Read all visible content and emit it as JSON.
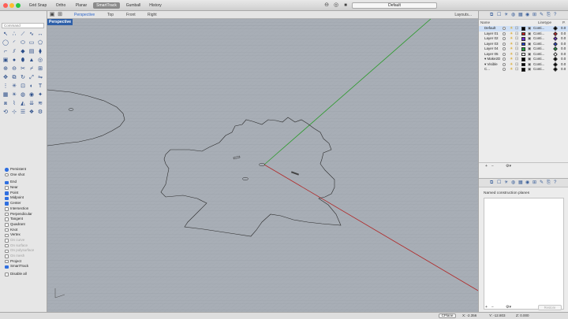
{
  "toolbar": {
    "toggles": [
      {
        "label": "Grid Snap",
        "active": false
      },
      {
        "label": "Ortho",
        "active": false
      },
      {
        "label": "Planar",
        "active": false
      },
      {
        "label": "SmartTrack",
        "active": true
      },
      {
        "label": "Gumball",
        "active": false
      },
      {
        "label": "History",
        "active": false
      }
    ],
    "layer_selector": "Default"
  },
  "viewport_tabs": [
    "Perspective",
    "Top",
    "Front",
    "Right"
  ],
  "active_tab": "Perspective",
  "layouts_label": "Layouts...",
  "command_placeholder": "Command",
  "viewport_label": "Perspective",
  "tools": [
    {
      "icon": "select-arrow-icon",
      "glyph": "↖"
    },
    {
      "icon": "points-icon",
      "glyph": "∴"
    },
    {
      "icon": "polyline-icon",
      "glyph": "⟋"
    },
    {
      "icon": "curve-icon",
      "glyph": "∿"
    },
    {
      "icon": "dimension-icon",
      "glyph": "↔"
    },
    {
      "icon": "circle-icon",
      "glyph": "◯"
    },
    {
      "icon": "arc-icon",
      "glyph": "◜"
    },
    {
      "icon": "ellipse-icon",
      "glyph": "⬭"
    },
    {
      "icon": "rectangle-icon",
      "glyph": "▭"
    },
    {
      "icon": "polygon-icon",
      "glyph": "⬠"
    },
    {
      "icon": "fillet-icon",
      "glyph": "⌐"
    },
    {
      "icon": "offset-icon",
      "glyph": "⫽"
    },
    {
      "icon": "surface-icon",
      "glyph": "◆"
    },
    {
      "icon": "extrude-icon",
      "glyph": "▤"
    },
    {
      "icon": "loft-icon",
      "glyph": "⧫"
    },
    {
      "icon": "box-icon",
      "glyph": "▣"
    },
    {
      "icon": "sphere-icon",
      "glyph": "●"
    },
    {
      "icon": "cylinder-icon",
      "glyph": "⬮"
    },
    {
      "icon": "cone-icon",
      "glyph": "▲"
    },
    {
      "icon": "torus-icon",
      "glyph": "◎"
    },
    {
      "icon": "boolean-union-icon",
      "glyph": "⊕"
    },
    {
      "icon": "boolean-diff-icon",
      "glyph": "⊖"
    },
    {
      "icon": "split-icon",
      "glyph": "✂"
    },
    {
      "icon": "trim-icon",
      "glyph": "⌿"
    },
    {
      "icon": "join-icon",
      "glyph": "⊞"
    },
    {
      "icon": "move-icon",
      "glyph": "✥"
    },
    {
      "icon": "copy-icon",
      "glyph": "⧉"
    },
    {
      "icon": "rotate-icon",
      "glyph": "↻"
    },
    {
      "icon": "scale-icon",
      "glyph": "⤢"
    },
    {
      "icon": "mirror-icon",
      "glyph": "⇋"
    },
    {
      "icon": "array-icon",
      "glyph": "⋮"
    },
    {
      "icon": "explode-icon",
      "glyph": "✳"
    },
    {
      "icon": "group-icon",
      "glyph": "⊡"
    },
    {
      "icon": "analyze-icon",
      "glyph": "◐"
    },
    {
      "icon": "text-icon",
      "glyph": "T"
    },
    {
      "icon": "grid-icon",
      "glyph": "▦"
    },
    {
      "icon": "render-icon",
      "glyph": "☀"
    },
    {
      "icon": "material-icon",
      "glyph": "◍"
    },
    {
      "icon": "camera-icon",
      "glyph": "◉"
    },
    {
      "icon": "light-icon",
      "glyph": "✦"
    },
    {
      "icon": "mesh-icon",
      "glyph": "⧈"
    },
    {
      "icon": "curve-edit-icon",
      "glyph": "⌇"
    },
    {
      "icon": "drape-icon",
      "glyph": "◭"
    },
    {
      "icon": "project-icon",
      "glyph": "⇊"
    },
    {
      "icon": "contour-icon",
      "glyph": "≋"
    },
    {
      "icon": "history-icon",
      "glyph": "⟲"
    },
    {
      "icon": "snap-icon",
      "glyph": "⊹"
    },
    {
      "icon": "layer-icon",
      "glyph": "☰"
    },
    {
      "icon": "plugin-icon",
      "glyph": "❖"
    },
    {
      "icon": "settings-icon",
      "glyph": "⚙"
    }
  ],
  "osnap": [
    {
      "label": "Persistent",
      "checked": true,
      "radio": true,
      "dim": false
    },
    {
      "label": "One shot",
      "checked": false,
      "radio": true,
      "dim": false
    },
    {
      "label": "End",
      "checked": true,
      "radio": false,
      "dim": false
    },
    {
      "label": "Near",
      "checked": false,
      "radio": false,
      "dim": false
    },
    {
      "label": "Point",
      "checked": true,
      "radio": false,
      "dim": false
    },
    {
      "label": "Midpoint",
      "checked": true,
      "radio": false,
      "dim": false
    },
    {
      "label": "Center",
      "checked": true,
      "radio": false,
      "dim": false
    },
    {
      "label": "Intersection",
      "checked": false,
      "radio": false,
      "dim": false
    },
    {
      "label": "Perpendicular",
      "checked": false,
      "radio": false,
      "dim": false
    },
    {
      "label": "Tangent",
      "checked": false,
      "radio": false,
      "dim": false
    },
    {
      "label": "Quadrant",
      "checked": false,
      "radio": false,
      "dim": false
    },
    {
      "label": "Knot",
      "checked": false,
      "radio": false,
      "dim": false
    },
    {
      "label": "Vertex",
      "checked": false,
      "radio": false,
      "dim": false
    },
    {
      "label": "On curve",
      "checked": false,
      "radio": false,
      "dim": true
    },
    {
      "label": "On surface",
      "checked": false,
      "radio": false,
      "dim": true
    },
    {
      "label": "On polysurface",
      "checked": false,
      "radio": false,
      "dim": true
    },
    {
      "label": "On mesh",
      "checked": false,
      "radio": false,
      "dim": true
    },
    {
      "label": "Project",
      "checked": false,
      "radio": false,
      "dim": false
    },
    {
      "label": "SmartTrack",
      "checked": true,
      "radio": false,
      "dim": false
    }
  ],
  "disable_all_label": "Disable all",
  "layers_panel": {
    "col_name": "Name",
    "col_linetype": "Linetype",
    "col_weight": "P.",
    "layers": [
      {
        "name": "Default",
        "color": "#000000",
        "linetype": "Conti...",
        "weight": "0.0",
        "selected": true
      },
      {
        "name": "Layer 01",
        "color": "#d02020",
        "linetype": "Conti...",
        "weight": "0.0",
        "selected": false
      },
      {
        "name": "Layer 02",
        "color": "#6a2bd0",
        "linetype": "Conti...",
        "weight": "0.0",
        "selected": false
      },
      {
        "name": "Layer 03",
        "color": "#2040d0",
        "linetype": "Conti...",
        "weight": "0.0",
        "selected": false
      },
      {
        "name": "Layer 04",
        "color": "#20a040",
        "linetype": "Conti...",
        "weight": "0.0",
        "selected": false
      },
      {
        "name": "Layer 05",
        "color": "#ffffff",
        "linetype": "Conti...",
        "weight": "0.0",
        "selected": false
      },
      {
        "name": "▾ Make2D",
        "color": "#000000",
        "linetype": "Conti...",
        "weight": "0.0",
        "selected": false
      },
      {
        "name": "▾ Visible",
        "color": "#000000",
        "linetype": "Conti...",
        "weight": "0.0",
        "selected": false
      },
      {
        "name": "C...",
        "color": "#000000",
        "linetype": "Conti...",
        "weight": "0.0",
        "selected": false
      }
    ]
  },
  "cplanes_title": "Named construction planes",
  "restore_label": "Restore",
  "status": {
    "cplane": "CPlane",
    "x": "X: -2.356",
    "y": "Y: -12.803",
    "z": "Z: 0.000"
  },
  "colors": {
    "viewport_bg": "#a8aeb6",
    "x_axis": "#b02a2a",
    "y_axis": "#2a9a2a",
    "active_blue": "#2f6fe0"
  }
}
